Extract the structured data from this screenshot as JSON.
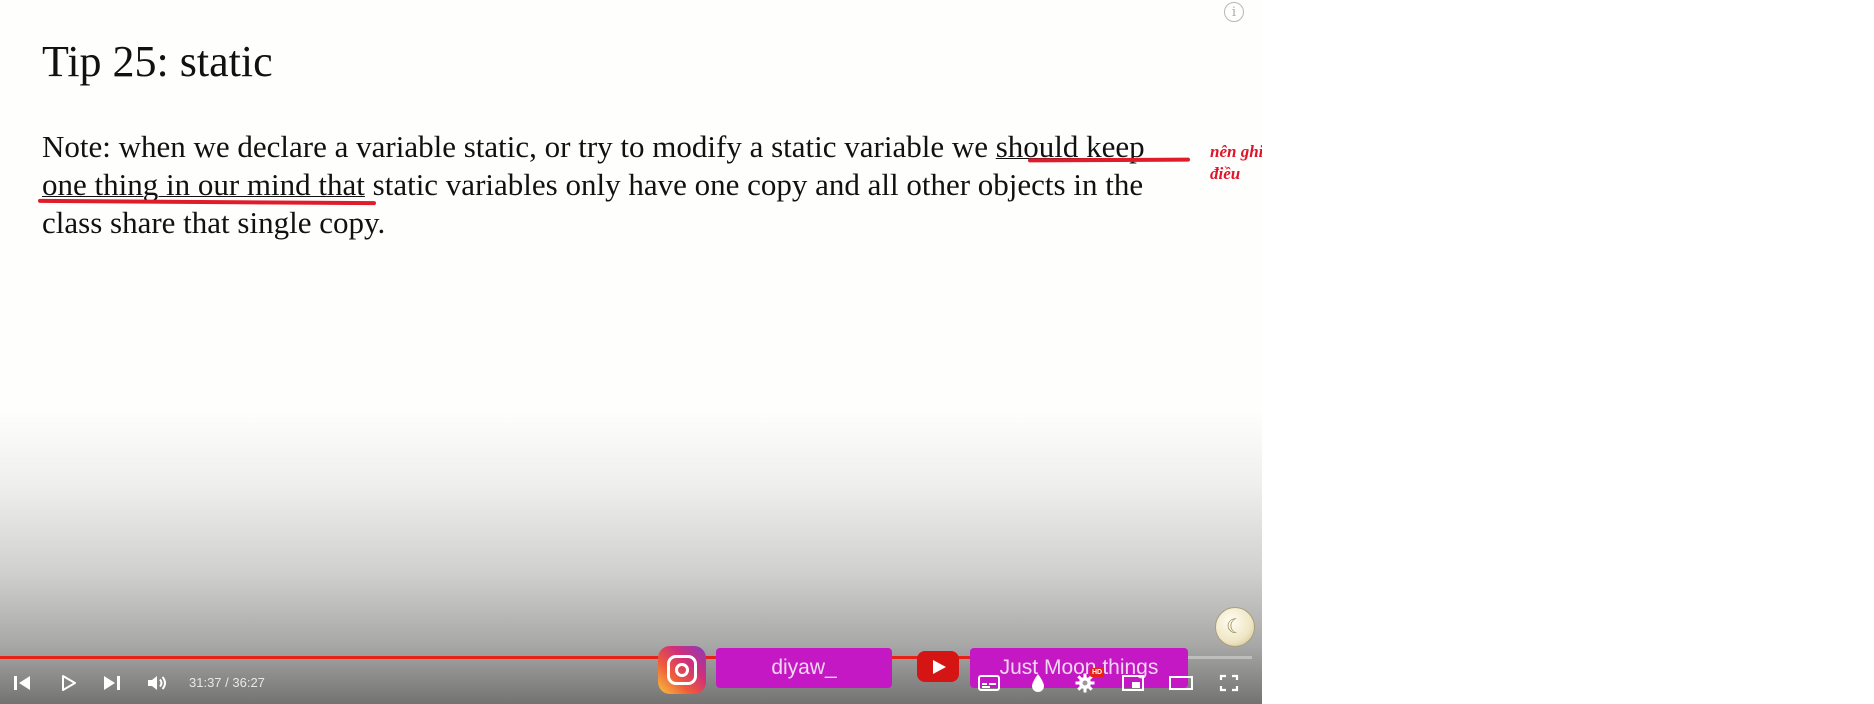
{
  "slide": {
    "title": "Tip 25: static",
    "body_segments": [
      "Note: when we declare a variable static, or try to modify a static variable we ",
      "should keep one thing in our mind that",
      " static variables only have one copy and all other objects in the class share that single copy."
    ]
  },
  "annotation": {
    "note": "nên ghi nhớ một điều",
    "color": "#e0142a"
  },
  "overlay": {
    "instagram_handle": "diyaw_",
    "youtube_channel": "Just Moon things",
    "pill_color": "#c418c4"
  },
  "player": {
    "time": "31:37 / 36:27",
    "progress": 0.867,
    "progress_color": "#e62117",
    "quality_badge": "HD",
    "icons": [
      "previous-icon",
      "play-icon",
      "next-icon",
      "volume-icon",
      "subtitles-icon",
      "autoplay-icon",
      "settings-icon",
      "miniplayer-icon",
      "theater-mode-icon",
      "fullscreen-icon",
      "info-icon"
    ]
  }
}
